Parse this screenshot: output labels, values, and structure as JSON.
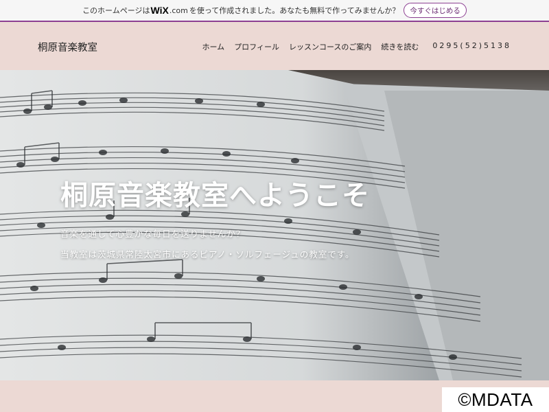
{
  "wix_bar": {
    "prefix": "このホームページは",
    "logo": "WiX",
    "dotcom": ".com",
    "suffix": "を使って作成されました。あなたも無料で作ってみませんか？",
    "cta_label": "今すぐはじめる",
    "accent_color": "#8c3f92"
  },
  "header": {
    "site_name": "桐原音楽教室",
    "nav": [
      {
        "label": "ホーム"
      },
      {
        "label": "プロフィール"
      },
      {
        "label": "レッスンコースのご案内"
      },
      {
        "label": "続きを読む"
      }
    ],
    "phone": "0295(52)5138",
    "background_color": "#ecd9d4"
  },
  "hero": {
    "title": "桐原音楽教室へようこそ",
    "line1": "音楽を通して心豊かな毎日を送りませんか？",
    "line2": "当教室は茨城県常陸太宮市にあるピアノ・ソルフェージュの教室です。",
    "image_subject": "sheet-music-photo"
  },
  "watermark": {
    "text": "©MDATA"
  }
}
